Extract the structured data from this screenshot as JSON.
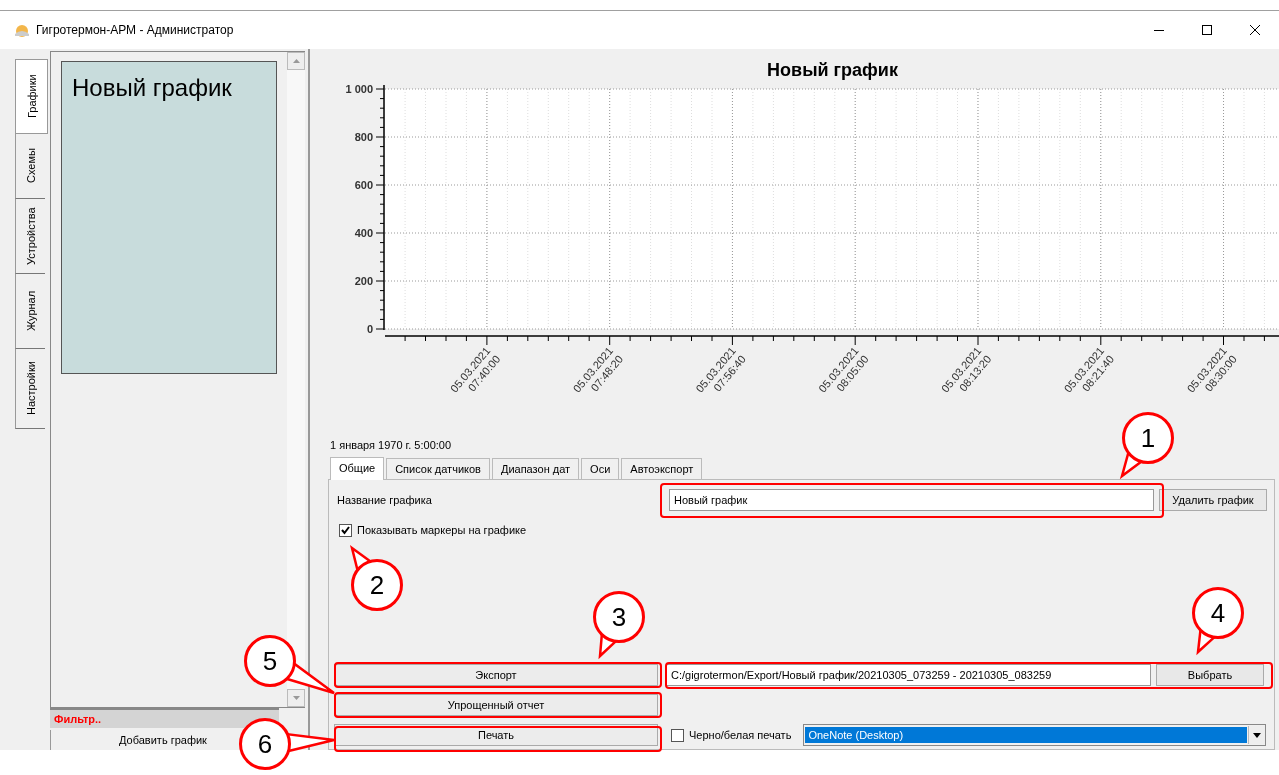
{
  "window": {
    "title": "Гигротермон-АРМ - Администратор"
  },
  "side_tabs": [
    {
      "label": "Графики",
      "selected": true
    },
    {
      "label": "Схемы",
      "selected": false
    },
    {
      "label": "Устройства",
      "selected": false
    },
    {
      "label": "Журнал",
      "selected": false
    },
    {
      "label": "Настройки",
      "selected": false
    }
  ],
  "graph_list": {
    "items": [
      {
        "label": "Новый график",
        "selected": true
      }
    ],
    "filter": "Фильтр..",
    "add_button": "Добавить график"
  },
  "chart": {
    "chart_data": {
      "type": "line",
      "title": "Новый график",
      "ylim": [
        0,
        1000
      ],
      "grid": true,
      "yticks": [
        0,
        200,
        400,
        600,
        800,
        {
          "value": 1000,
          "label": "1 000"
        }
      ],
      "categories": [
        "05.03.2021 07:40:00",
        "05.03.2021 07:48:20",
        "05.03.2021 07:56:40",
        "05.03.2021 08:05:00",
        "05.03.2021 08:13:20",
        "05.03.2021 08:21:40",
        "05.03.2021 08:30:00"
      ]
    },
    "cursor_time": "1 января 1970 г. 5:00:00"
  },
  "settings_tabs": [
    {
      "label": "Общие",
      "selected": true
    },
    {
      "label": "Список датчиков",
      "selected": false
    },
    {
      "label": "Диапазон дат",
      "selected": false
    },
    {
      "label": "Оси",
      "selected": false
    },
    {
      "label": "Автоэкспорт",
      "selected": false
    }
  ],
  "general": {
    "name_label": "Название графика",
    "name_value": "Новый график",
    "delete_button": "Удалить график",
    "show_markers": {
      "label": "Показывать маркеры на графике",
      "checked": true
    },
    "export_button": "Экспорт",
    "export_path": "C:/gigrotermon/Export/Новый график/20210305_073259 - 20210305_083259",
    "choose_button": "Выбрать",
    "simple_report_button": "Упрощенный отчет",
    "print_button": "Печать",
    "bw_print": {
      "label": "Черно/белая печать",
      "checked": false
    },
    "printer": {
      "value": "OneNote (Desktop)",
      "focused": true
    }
  },
  "annotations": [
    {
      "label": "1"
    },
    {
      "label": "2"
    },
    {
      "label": "3"
    },
    {
      "label": "4"
    },
    {
      "label": "5"
    },
    {
      "label": "6"
    }
  ]
}
